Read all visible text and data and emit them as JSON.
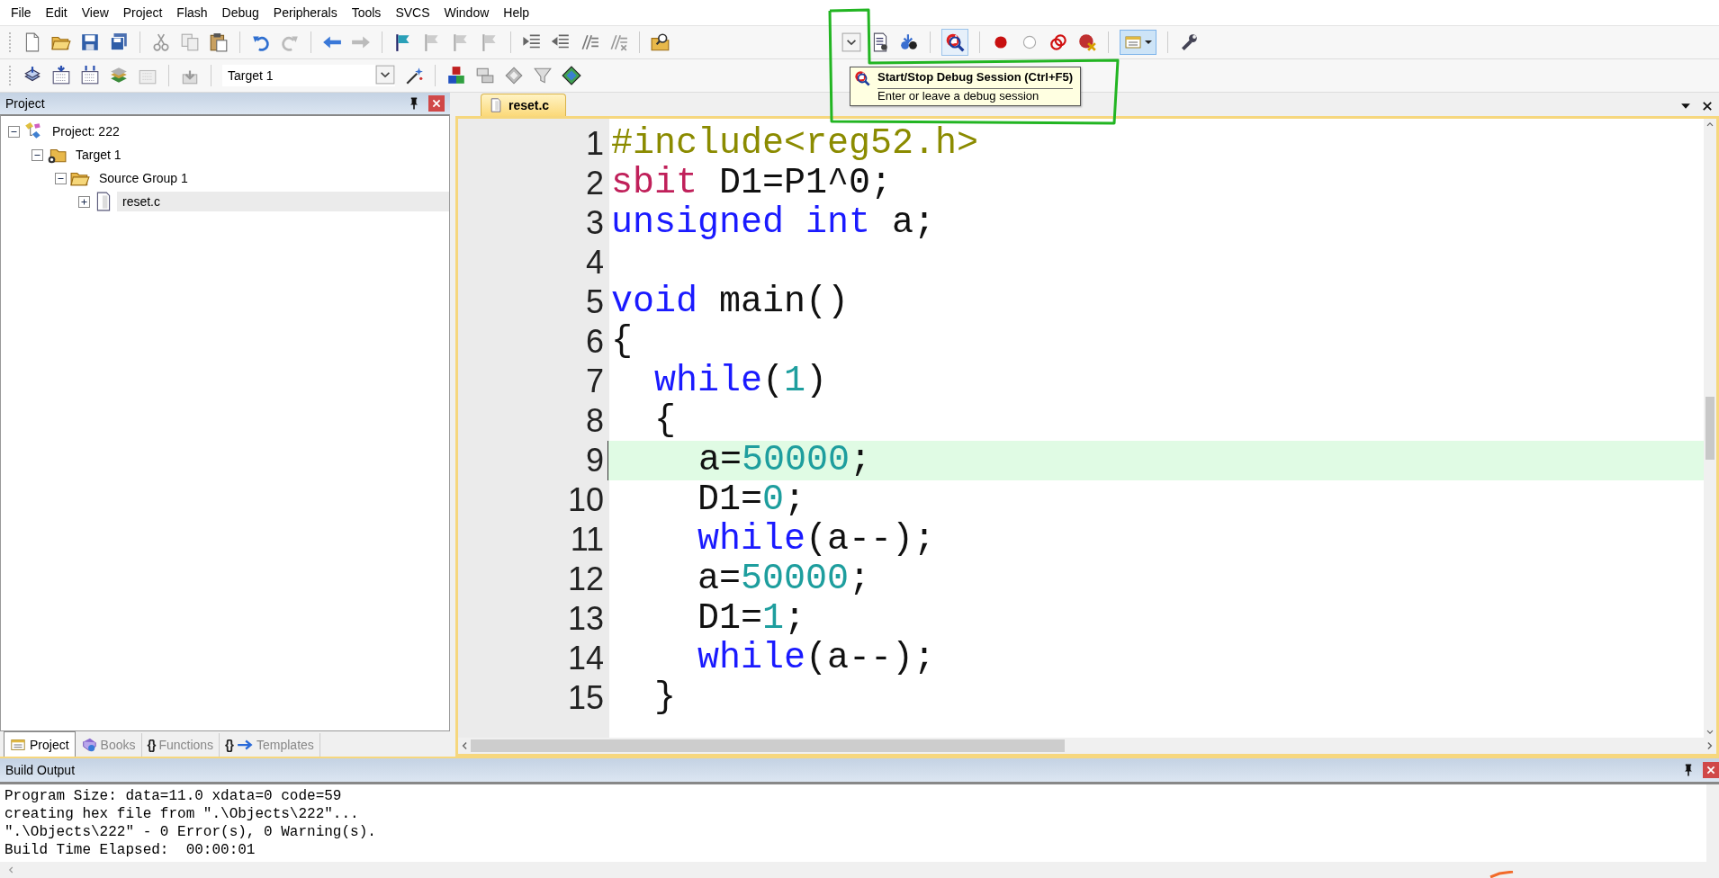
{
  "menu": [
    {
      "label": "File"
    },
    {
      "label": "Edit"
    },
    {
      "label": "View"
    },
    {
      "label": "Project"
    },
    {
      "label": "Flash"
    },
    {
      "label": "Debug"
    },
    {
      "label": "Peripherals"
    },
    {
      "label": "Tools"
    },
    {
      "label": "SVCS"
    },
    {
      "label": "Window"
    },
    {
      "label": "Help"
    }
  ],
  "target": {
    "value": "Target 1"
  },
  "tooltip": {
    "title": "Start/Stop Debug Session (Ctrl+F5)",
    "text": "Enter or leave a debug session"
  },
  "project_panel": {
    "title": "Project",
    "tree": [
      {
        "label": "Project: 222",
        "kind": "project",
        "expanded": true,
        "selected": false,
        "children": [
          {
            "label": "Target 1",
            "kind": "target",
            "expanded": true,
            "selected": false,
            "children": [
              {
                "label": "Source Group 1",
                "kind": "group",
                "expanded": true,
                "selected": false,
                "children": [
                  {
                    "label": "reset.c",
                    "kind": "file",
                    "expanded": false,
                    "selected": true
                  }
                ]
              }
            ]
          }
        ]
      }
    ],
    "tabs": [
      {
        "label": "Project",
        "kind": "project",
        "selected": true
      },
      {
        "label": "Books",
        "kind": "books",
        "selected": false
      },
      {
        "label": "Functions",
        "kind": "functions",
        "glyph": "{}",
        "selected": false
      },
      {
        "label": "Templates",
        "kind": "templates",
        "glyph": "{}",
        "selected": false
      }
    ]
  },
  "editor": {
    "tab": "reset.c",
    "lines": [
      {
        "number": "1",
        "highlighted": false,
        "tokens": [
          {
            "text": "#include<reg52.h>",
            "kind": "preproc"
          }
        ]
      },
      {
        "number": "2",
        "highlighted": false,
        "tokens": [
          {
            "text": "sbit",
            "kind": "sfr"
          },
          {
            "text": " D1=P1^0;",
            "kind": "plain"
          }
        ]
      },
      {
        "number": "3",
        "highlighted": false,
        "tokens": [
          {
            "text": "unsigned int",
            "kind": "keyword"
          },
          {
            "text": " a;",
            "kind": "plain"
          }
        ]
      },
      {
        "number": "4",
        "highlighted": false
      },
      {
        "number": "5",
        "highlighted": false,
        "tokens": [
          {
            "text": "void",
            "kind": "keyword"
          },
          {
            "text": " main()",
            "kind": "plain"
          }
        ]
      },
      {
        "number": "6",
        "highlighted": false,
        "tokens": [
          {
            "text": "{",
            "kind": "plain"
          }
        ]
      },
      {
        "number": "7",
        "highlighted": false,
        "tokens": [
          {
            "text": "  while",
            "kind": "keyword"
          },
          {
            "text": "(",
            "kind": "plain"
          },
          {
            "text": "1",
            "kind": "number"
          },
          {
            "text": ")",
            "kind": "plain"
          }
        ]
      },
      {
        "number": "8",
        "highlighted": false,
        "tokens": [
          {
            "text": "  {",
            "kind": "plain"
          }
        ]
      },
      {
        "number": "9",
        "highlighted": true,
        "tokens": [
          {
            "text": "    a=",
            "kind": "plain"
          },
          {
            "text": "50000",
            "kind": "number"
          },
          {
            "text": ";",
            "kind": "plain"
          }
        ]
      },
      {
        "number": "10",
        "highlighted": false,
        "tokens": [
          {
            "text": "    D1=",
            "kind": "plain"
          },
          {
            "text": "0",
            "kind": "number"
          },
          {
            "text": ";",
            "kind": "plain"
          }
        ]
      },
      {
        "number": "11",
        "highlighted": false,
        "tokens": [
          {
            "text": "    while",
            "kind": "keyword"
          },
          {
            "text": "(a--);",
            "kind": "plain"
          }
        ]
      },
      {
        "number": "12",
        "highlighted": false,
        "tokens": [
          {
            "text": "    a=",
            "kind": "plain"
          },
          {
            "text": "50000",
            "kind": "number"
          },
          {
            "text": ";",
            "kind": "plain"
          }
        ]
      },
      {
        "number": "13",
        "highlighted": false,
        "tokens": [
          {
            "text": "    D1=",
            "kind": "plain"
          },
          {
            "text": "1",
            "kind": "number"
          },
          {
            "text": ";",
            "kind": "plain"
          }
        ]
      },
      {
        "number": "14",
        "highlighted": false,
        "tokens": [
          {
            "text": "    while",
            "kind": "keyword"
          },
          {
            "text": "(a--);",
            "kind": "plain"
          }
        ]
      },
      {
        "number": "15",
        "highlighted": false,
        "tokens": [
          {
            "text": "  }",
            "kind": "plain"
          }
        ]
      }
    ]
  },
  "build_output": {
    "title": "Build Output",
    "lines": [
      "Program Size: data=11.0 xdata=0 code=59",
      "creating hex file from \".\\Objects\\222\"...",
      "\".\\Objects\\222\" - 0 Error(s), 0 Warning(s).",
      "Build Time Elapsed:  00:00:01"
    ]
  }
}
